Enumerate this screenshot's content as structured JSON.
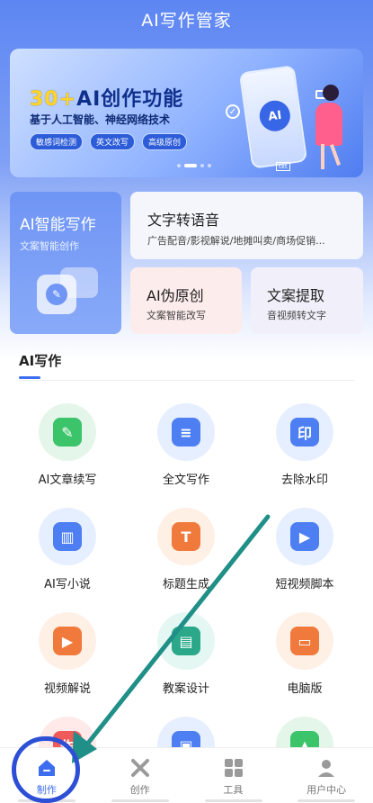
{
  "app": {
    "title": "AI写作管家"
  },
  "banner": {
    "headline_accent": "30+",
    "headline_rest": "AI创作功能",
    "subtitle": "基于人工智能、神经网络技术",
    "tags": [
      "敏感词检测",
      "英文改写",
      "高级原创"
    ],
    "phone_label": "AI",
    "badge": "txt"
  },
  "features": {
    "smart_write": {
      "title": "AI智能写作",
      "subtitle": "文案智能创作"
    },
    "tts": {
      "title": "文字转语音",
      "subtitle": "广告配音/影视解说/地摊叫卖/商场促销..."
    },
    "pseudo": {
      "title": "AI伪原创",
      "subtitle": "文案智能改写"
    },
    "extract": {
      "title": "文案提取",
      "subtitle": "音视频转文字"
    }
  },
  "section": {
    "title": "AI写作"
  },
  "tools": [
    {
      "label": "AI文章续写",
      "icon": "pen-icon",
      "bg": "#e4f6ea",
      "fg": "#3cc46a",
      "glyph": "✎"
    },
    {
      "label": "全文写作",
      "icon": "document-icon",
      "bg": "#e6efff",
      "fg": "#4d7ff2",
      "glyph": "≡"
    },
    {
      "label": "去除水印",
      "icon": "stamp-icon",
      "bg": "#e6efff",
      "fg": "#4d7ff2",
      "glyph": "印"
    },
    {
      "label": "AI写小说",
      "icon": "book-icon",
      "bg": "#e6efff",
      "fg": "#4d7ff2",
      "glyph": "▥"
    },
    {
      "label": "标题生成",
      "icon": "title-icon",
      "bg": "#fff0e6",
      "fg": "#f07a3c",
      "glyph": "T"
    },
    {
      "label": "短视频脚本",
      "icon": "video-camera-icon",
      "bg": "#e6efff",
      "fg": "#4d7ff2",
      "glyph": "▶"
    },
    {
      "label": "视频解说",
      "icon": "film-icon",
      "bg": "#fff0e6",
      "fg": "#f07a3c",
      "glyph": "▶"
    },
    {
      "label": "教案设计",
      "icon": "notebook-icon",
      "bg": "#e4f7f3",
      "fg": "#2aa889",
      "glyph": "▤"
    },
    {
      "label": "电脑版",
      "icon": "monitor-icon",
      "bg": "#fff0e6",
      "fg": "#f07a3c",
      "glyph": "▭"
    }
  ],
  "partial_tools": [
    {
      "icon": "partial-red-icon",
      "bg": "#ffe9e9",
      "fg": "#ef5a5a",
      "glyph": "作"
    },
    {
      "icon": "partial-save-icon",
      "bg": "#e6efff",
      "fg": "#4d7ff2",
      "glyph": "▣"
    },
    {
      "icon": "partial-green-icon",
      "bg": "#e4f6ea",
      "fg": "#3cc46a",
      "glyph": "▲"
    }
  ],
  "nav": [
    {
      "label": "制作",
      "icon": "home-icon",
      "active": true
    },
    {
      "label": "创作",
      "icon": "tools-icon",
      "active": false
    },
    {
      "label": "工具",
      "icon": "grid-icon",
      "active": false
    },
    {
      "label": "用户中心",
      "icon": "user-icon",
      "active": false
    }
  ],
  "colors": {
    "accent": "#3d6ef0",
    "annotation": "#1f8f87",
    "ring": "#2d4fd6"
  }
}
